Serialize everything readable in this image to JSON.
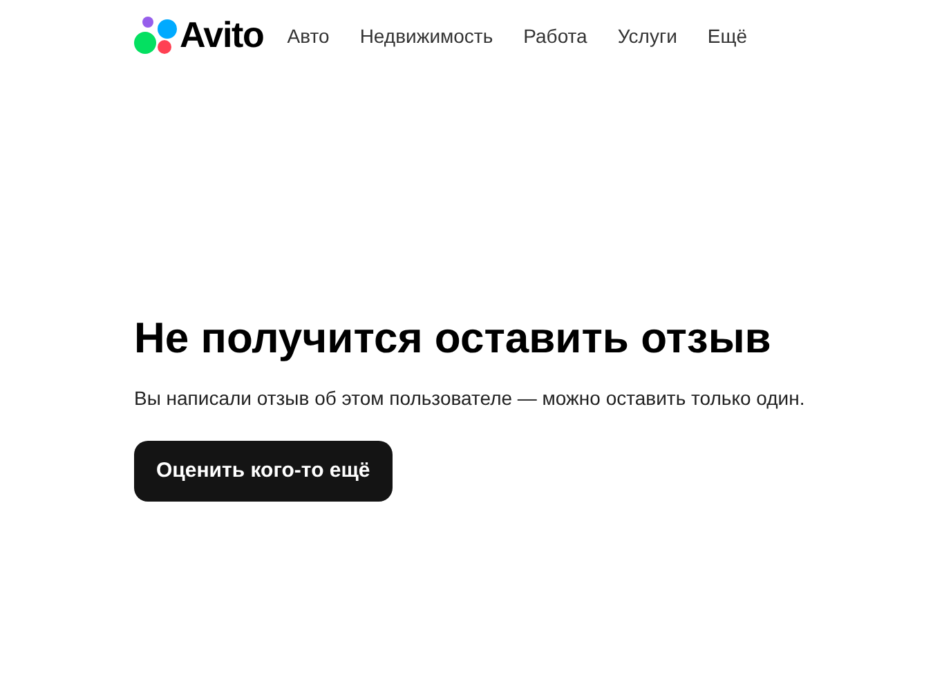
{
  "header": {
    "logo": "Avito",
    "nav": [
      "Авто",
      "Недвижимость",
      "Работа",
      "Услуги",
      "Ещё"
    ]
  },
  "message": {
    "title": "Не получится оставить отзыв",
    "text": "Вы написали отзыв об этом пользователе — можно оставить только один.",
    "button": "Оценить кого-то ещё"
  }
}
